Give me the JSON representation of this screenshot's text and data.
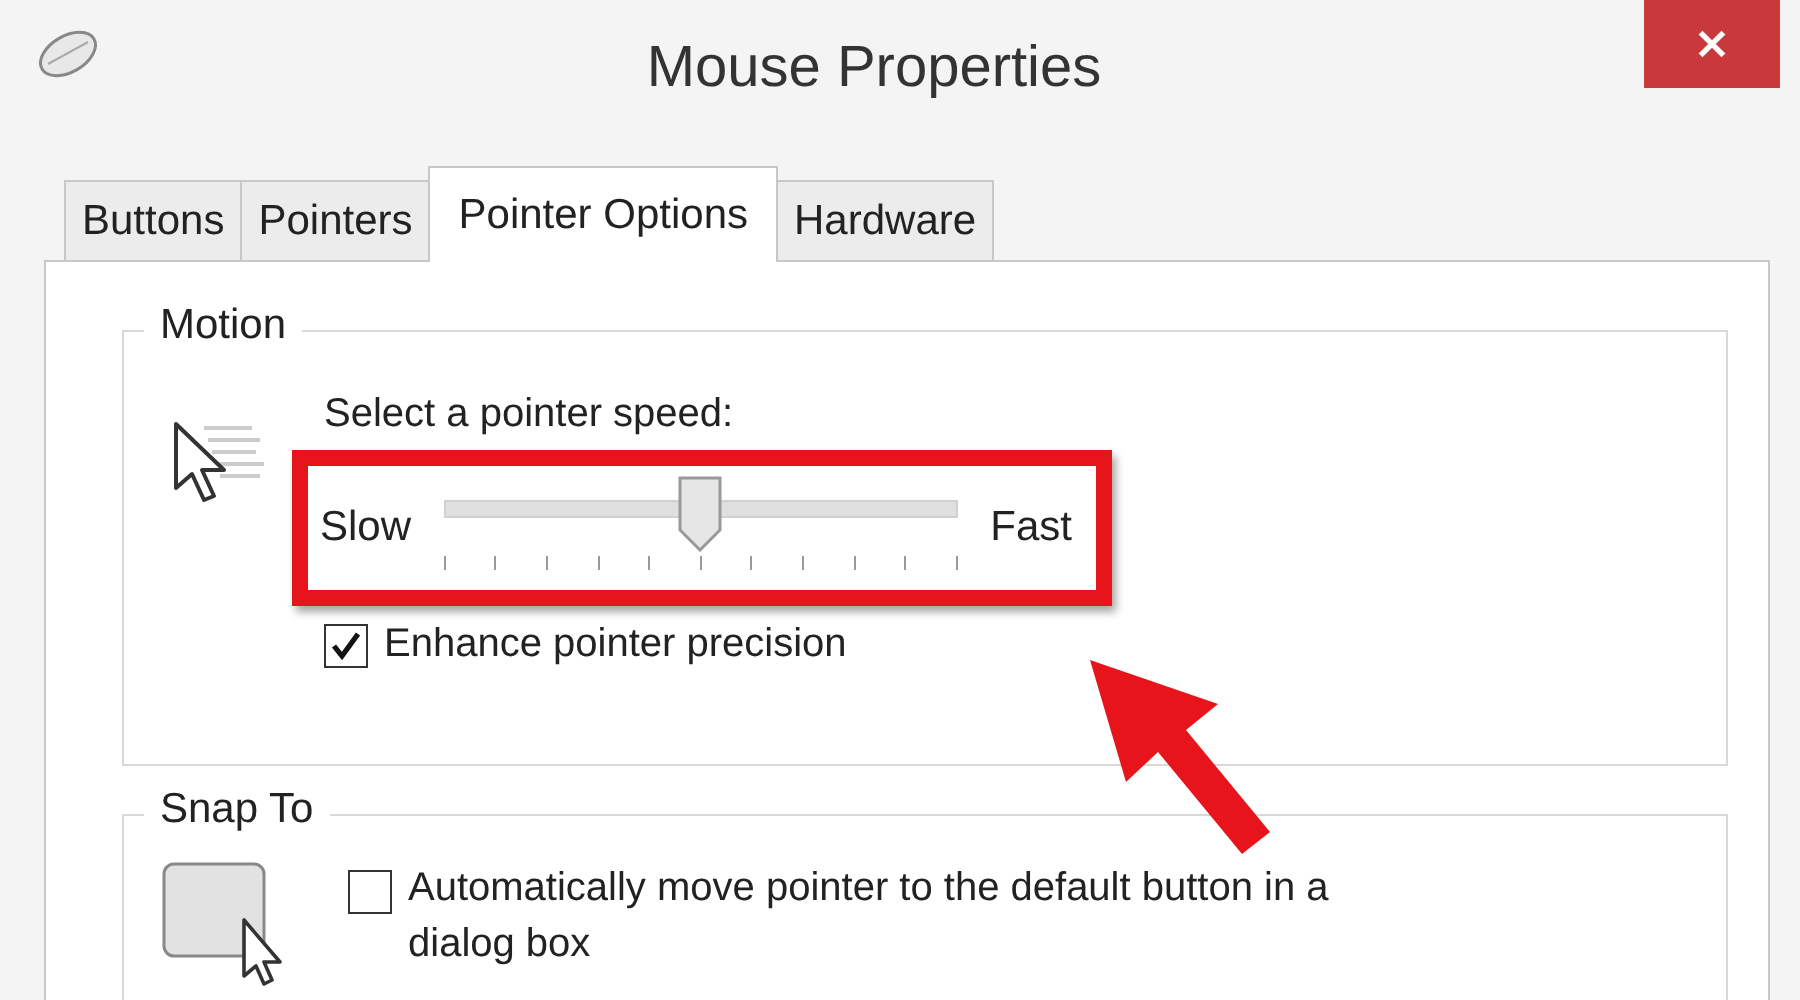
{
  "window": {
    "title": "Mouse Properties"
  },
  "tabs": [
    {
      "label": "Buttons",
      "selected": false
    },
    {
      "label": "Pointers",
      "selected": false
    },
    {
      "label": "Pointer Options",
      "selected": true
    },
    {
      "label": "Hardware",
      "selected": false
    }
  ],
  "motion": {
    "legend": "Motion",
    "speed_label": "Select a pointer speed:",
    "slider": {
      "min_label": "Slow",
      "max_label": "Fast",
      "level": 0.5
    },
    "enhance_precision": {
      "label": "Enhance pointer precision",
      "checked": true
    }
  },
  "snap_to": {
    "legend": "Snap To",
    "auto_move": {
      "label": "Automatically move pointer to the default button in a dialog box",
      "checked": false
    }
  }
}
